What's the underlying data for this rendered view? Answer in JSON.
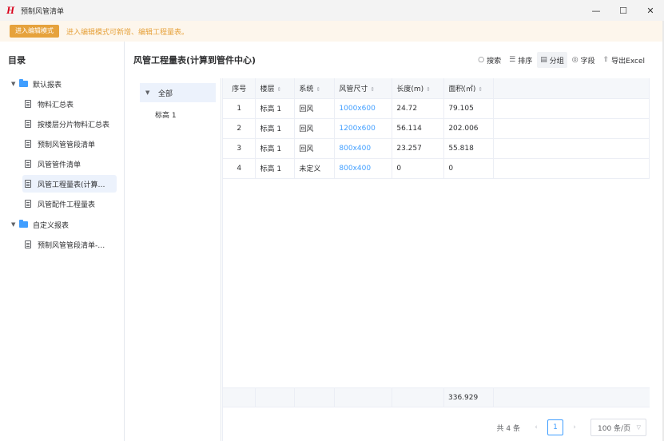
{
  "window": {
    "title": "预制风管清单",
    "minimize": "—",
    "maximize": "☐",
    "close": "✕"
  },
  "banner": {
    "button": "进入编辑模式",
    "hint": "进入编辑模式可新增、编辑工程量表。"
  },
  "sidebar": {
    "title": "目录",
    "folders": [
      {
        "label": "默认报表",
        "items": [
          "物料汇总表",
          "按楼层分片物料汇总表",
          "预制风管管段清单",
          "风管管件清单",
          "风管工程量表(计算…",
          "风管配件工程量表"
        ]
      },
      {
        "label": "自定义报表",
        "items": [
          "预制风管管段清单-…"
        ]
      }
    ]
  },
  "main": {
    "title": "风管工程量表(计算到管件中心)",
    "toolbar": {
      "search": "搜索",
      "sort": "排序",
      "group": "分组",
      "fields": "字段",
      "export": "导出Excel",
      "icons": {
        "search": "search-icon",
        "sort": "sort-icon",
        "group": "group-icon",
        "fields": "fields-icon",
        "export": "export-icon"
      }
    },
    "groups": [
      "全部",
      "标高 1"
    ],
    "table": {
      "headers": [
        "序号",
        "楼层",
        "系统",
        "风管尺寸",
        "长度(m)",
        "面积(㎡)"
      ],
      "rows": [
        [
          "1",
          "标高 1",
          "回风",
          "1000x600",
          "24.72",
          "79.105"
        ],
        [
          "2",
          "标高 1",
          "回风",
          "1200x600",
          "56.114",
          "202.006"
        ],
        [
          "3",
          "标高 1",
          "回风",
          "800x400",
          "23.257",
          "55.818"
        ],
        [
          "4",
          "标高 1",
          "未定义",
          "800x400",
          "0",
          "0"
        ]
      ],
      "summary_area": "336.929"
    },
    "pagination": {
      "total": "共 4 条",
      "page": "1",
      "page_size": "100 条/页"
    }
  },
  "colors": {
    "accent": "#409eff",
    "warning": "#e6a23c",
    "logo": "#d9001b"
  }
}
